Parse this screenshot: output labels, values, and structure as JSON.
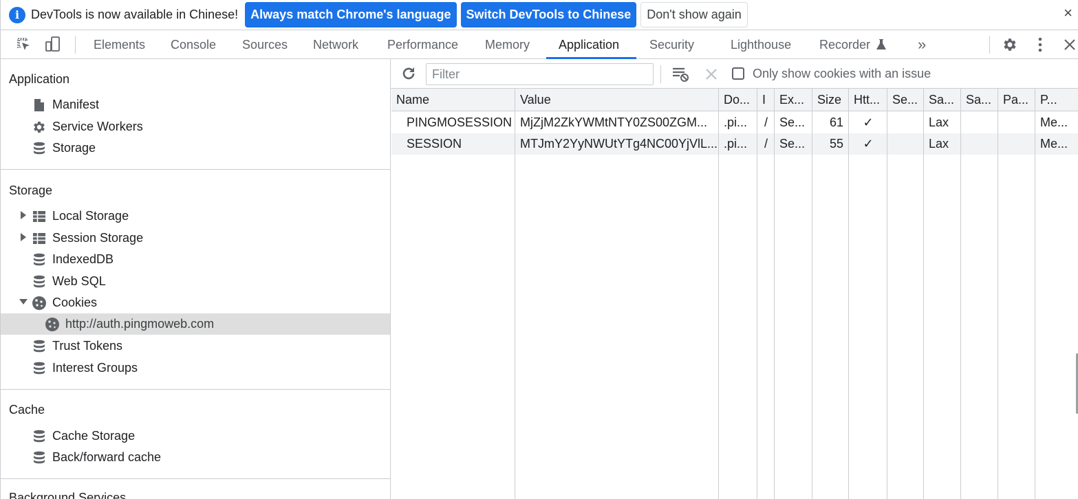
{
  "infobar": {
    "message": "DevTools is now available in Chinese!",
    "btn_match": "Always match Chrome's language",
    "btn_switch": "Switch DevTools to Chinese",
    "btn_dont_show": "Don't show again",
    "close": "×"
  },
  "tabs": {
    "elements": "Elements",
    "console": "Console",
    "sources": "Sources",
    "network": "Network",
    "performance": "Performance",
    "memory": "Memory",
    "application": "Application",
    "security": "Security",
    "lighthouse": "Lighthouse",
    "recorder": "Recorder",
    "more": "»",
    "active": "Application",
    "accent_color": "#1a73e8"
  },
  "sidebar": {
    "application_title": "Application",
    "manifest": "Manifest",
    "service_workers": "Service Workers",
    "storage_item": "Storage",
    "storage_title": "Storage",
    "local_storage": "Local Storage",
    "session_storage": "Session Storage",
    "indexeddb": "IndexedDB",
    "web_sql": "Web SQL",
    "cookies": "Cookies",
    "cookie_origin": "http://auth.pingmoweb.com",
    "trust_tokens": "Trust Tokens",
    "interest_groups": "Interest Groups",
    "cache_title": "Cache",
    "cache_storage": "Cache Storage",
    "bfcache": "Back/forward cache",
    "background_title": "Background Services"
  },
  "toolbar": {
    "filter_placeholder": "Filter",
    "only_issues_label": "Only show cookies with an issue",
    "only_issues_checked": false
  },
  "table": {
    "headers": [
      "Name",
      "Value",
      "Do...",
      "I",
      "Ex...",
      "Size",
      "Htt...",
      "Se...",
      "Sa...",
      "Sa...",
      "Pa...",
      "P..."
    ],
    "rows": [
      [
        "PINGMOSESSION",
        "MjZjM2ZkYWMtNTY0ZS00ZGM...",
        ".pi...",
        "/",
        "Se...",
        "61",
        "✓",
        "",
        "Lax",
        "",
        "",
        "Me..."
      ],
      [
        "SESSION",
        "MTJmY2YyNWUtYTg4NC00YjVlL...",
        ".pi...",
        "/",
        "Se...",
        "55",
        "✓",
        "",
        "Lax",
        "",
        "",
        "Me..."
      ]
    ]
  },
  "icons": {
    "info": "info-icon",
    "inspect": "inspect-element-icon",
    "device": "device-toolbar-icon",
    "refresh": "refresh-icon",
    "clear_filtered": "clear-filtered-icon",
    "delete": "delete-icon",
    "settings": "gear-icon",
    "kebab": "more-vert-icon",
    "close": "close-icon"
  }
}
